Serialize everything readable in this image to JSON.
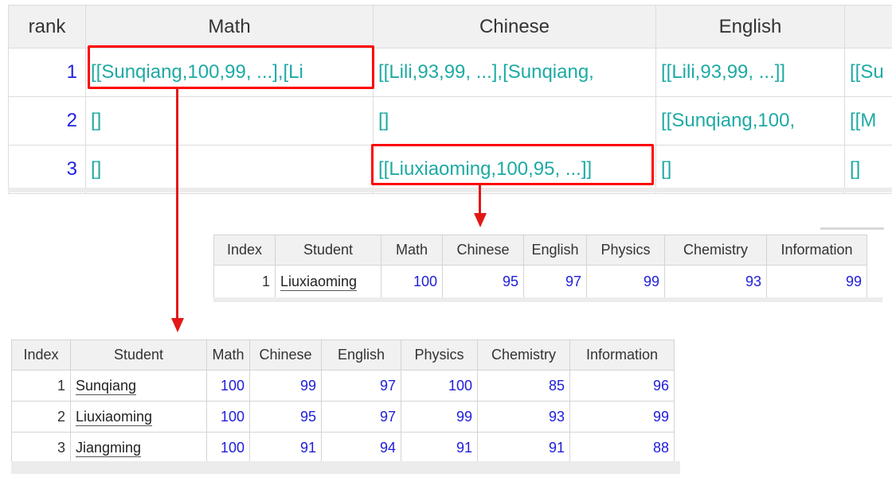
{
  "main_grid": {
    "headers": [
      "rank",
      "Math",
      "Chinese",
      "English",
      ""
    ],
    "rows": [
      {
        "rank": "1",
        "math": "[[Sunqiang,100,99, ...],[Li",
        "chinese": "[[Lili,93,99, ...],[Sunqiang,",
        "english": "[[Lili,93,99, ...]]",
        "extra": "[[Su"
      },
      {
        "rank": "2",
        "math": "[]",
        "chinese": "[]",
        "english": "[[Sunqiang,100,",
        "extra": "[[M"
      },
      {
        "rank": "3",
        "math": "[]",
        "chinese": "[[Liuxiaoming,100,95, ...]]",
        "english": "[]",
        "extra": "[]"
      }
    ]
  },
  "sub_grid_chinese_rank3": {
    "headers": [
      "Index",
      "Student",
      "Math",
      "Chinese",
      "English",
      "Physics",
      "Chemistry",
      "Information"
    ],
    "rows": [
      {
        "index": "1",
        "student": "Liuxiaoming",
        "math": "100",
        "chinese": "95",
        "english": "97",
        "physics": "99",
        "chemistry": "93",
        "information": "99"
      }
    ]
  },
  "sub_grid_math_rank1": {
    "headers": [
      "Index",
      "Student",
      "Math",
      "Chinese",
      "English",
      "Physics",
      "Chemistry",
      "Information"
    ],
    "rows": [
      {
        "index": "1",
        "student": "Sunqiang",
        "math": "100",
        "chinese": "99",
        "english": "97",
        "physics": "100",
        "chemistry": "85",
        "information": "96"
      },
      {
        "index": "2",
        "student": "Liuxiaoming",
        "math": "100",
        "chinese": "95",
        "english": "97",
        "physics": "99",
        "chemistry": "93",
        "information": "99"
      },
      {
        "index": "3",
        "student": "Jiangming",
        "math": "100",
        "chinese": "91",
        "english": "94",
        "physics": "91",
        "chemistry": "91",
        "information": "88"
      }
    ]
  },
  "colors": {
    "highlight": "#ff0000",
    "arrow": "#e21818",
    "sequence_text": "#1eaaa4",
    "number_text": "#2020e0",
    "header_bg": "#f1f1f1"
  }
}
